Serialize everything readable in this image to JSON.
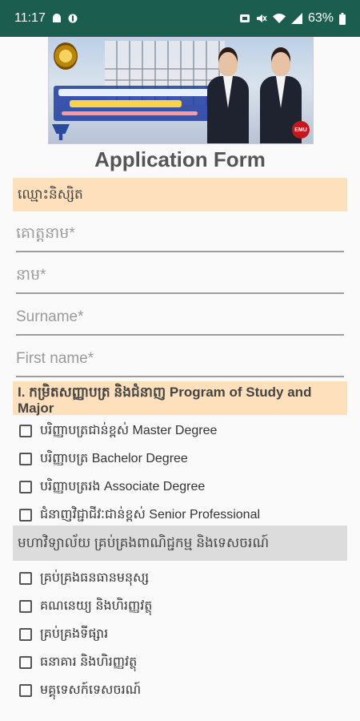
{
  "status_bar": {
    "time": "11:17",
    "battery": "63%",
    "icons": [
      "cloud-icon",
      "alarm-icon",
      "mute-icon",
      "wifi-icon",
      "signal-icon",
      "battery-icon"
    ]
  },
  "banner": {
    "badge": "EMU"
  },
  "form": {
    "title": "Application Form",
    "section_name": "ឈ្មោះនិស្សិត",
    "fields": [
      {
        "placeholder": "គោត្តនាម*",
        "value": ""
      },
      {
        "placeholder": "នាម*",
        "value": ""
      },
      {
        "placeholder": "Surname*",
        "value": ""
      },
      {
        "placeholder": "First name*",
        "value": ""
      }
    ],
    "section_program": "I. កម្រិតសញ្ញាបត្រ និងជំនាញ Program of Study and Major",
    "degrees": [
      "បរិញ្ញាបត្រជាន់ខ្ពស់ Master Degree",
      "បរិញ្ញាបត្រ Bachelor Degree",
      "បរិញ្ញាបត្ររង Associate Degree",
      "ជំនាញវិជ្ជាជីវៈជាន់ខ្ពស់ Senior Professional"
    ],
    "section_faculty": "មហាវិទ្យាល័យ គ្រប់គ្រងពាណិជ្ជកម្ម និងទេសចរណ៍",
    "majors": [
      "គ្រប់គ្រងធនធានមនុស្ស",
      "គណនេយ្យ និងហិរញ្ញវត្ថុ",
      "គ្រប់គ្រងទីផ្សារ",
      "ធនាគារ និងហិរញ្ញវត្ថុ",
      "មគ្គុទេសក៍ទេសចរណ៍"
    ]
  },
  "colors": {
    "status_bar": "#1b5e4f",
    "section_highlight": "#ffe0bc",
    "section_grey": "#dcdcdc"
  }
}
